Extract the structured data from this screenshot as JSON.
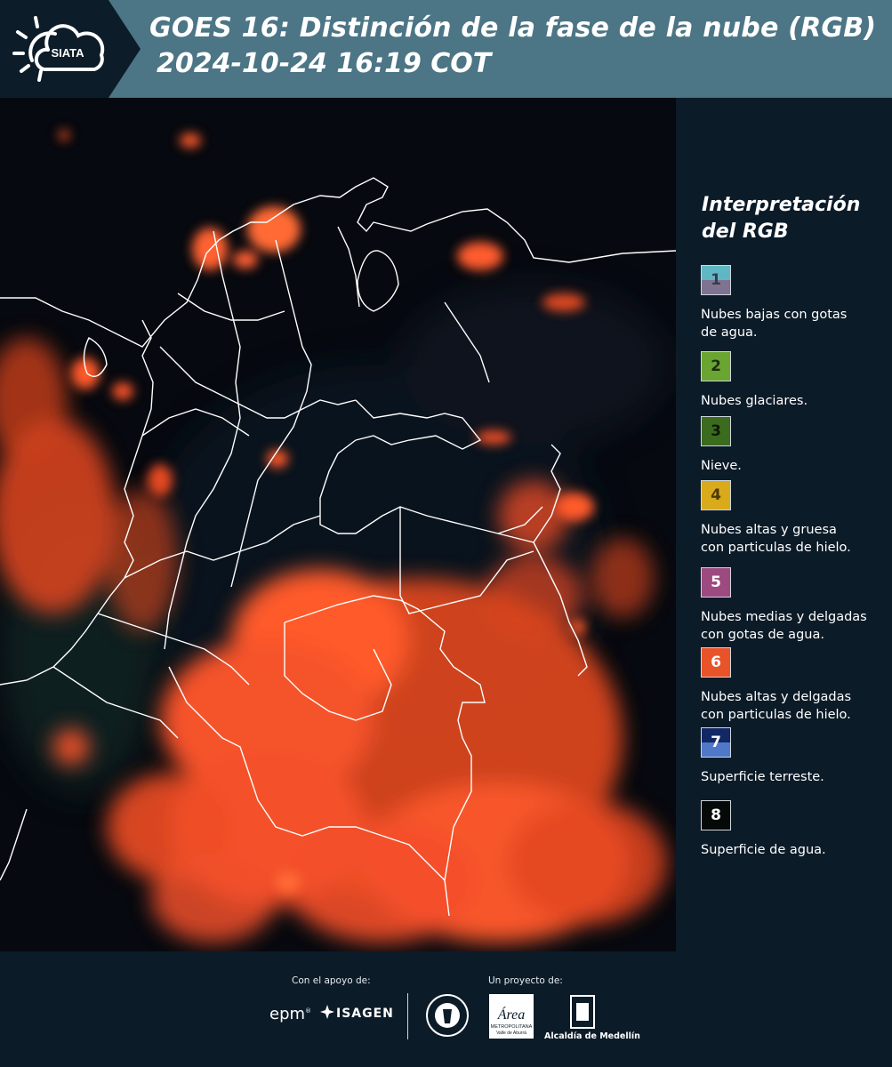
{
  "header": {
    "logo_text": "SIATA",
    "title_line1": "GOES 16: Distinción de la fase de la nube (RGB)",
    "title_line2": "2024-10-24 16:19 COT"
  },
  "legend": {
    "title_line1": "Interpretación",
    "title_line2": "del RGB",
    "items": [
      {
        "num": "1",
        "label_lines": [
          "Nubes bajas con gotas",
          "de agua."
        ],
        "colors": [
          "#5fb7c4",
          "#7e7492"
        ],
        "num_color": "#3a3a4a"
      },
      {
        "num": "2",
        "label_lines": [
          "Nubes glaciares."
        ],
        "colors": [
          "#6aa532",
          "#6aa532"
        ],
        "num_color": "#1f2d12"
      },
      {
        "num": "3",
        "label_lines": [
          "Nieve."
        ],
        "colors": [
          "#3a6b1e",
          "#3a6b1e"
        ],
        "num_color": "#0e1a08"
      },
      {
        "num": "4",
        "label_lines": [
          "Nubes altas y gruesa",
          "con particulas de hielo."
        ],
        "colors": [
          "#d9aa1a",
          "#d9aa1a"
        ],
        "num_color": "#4a3a0a"
      },
      {
        "num": "5",
        "label_lines": [
          "Nubes medias y delgadas",
          "con gotas de agua."
        ],
        "colors": [
          "#9c4a7f",
          "#9c4a7f"
        ],
        "num_color": "#ffffff"
      },
      {
        "num": "6",
        "label_lines": [
          "Nubes altas y delgadas",
          "con particulas de hielo."
        ],
        "colors": [
          "#e8532a",
          "#e8532a"
        ],
        "num_color": "#ffffff"
      },
      {
        "num": "7",
        "label_lines": [
          "Superficie terreste."
        ],
        "colors": [
          "#122864",
          "#4f78c8"
        ],
        "num_color": "#ffffff"
      },
      {
        "num": "8",
        "label_lines": [
          "Superficie de agua."
        ],
        "colors": [
          "#050a08",
          "#050a08"
        ],
        "num_color": "#ffffff"
      }
    ]
  },
  "footer": {
    "support_label": "Con el apoyo de:",
    "project_label": "Un proyecto de:",
    "sponsor1": "epm",
    "sponsor2": "ISAGEN",
    "partner_area_line1": "Área",
    "partner_area_line2": "METROPOLITANA",
    "partner_area_line3": "Valle de Aburrá",
    "partner_alcaldia": "Alcaldía de Medellín"
  },
  "colors": {
    "header_band": "#4c7586",
    "background": "#0c1b28",
    "cloud_orange": "#ff5a2a",
    "border_lines": "#ffffff"
  }
}
